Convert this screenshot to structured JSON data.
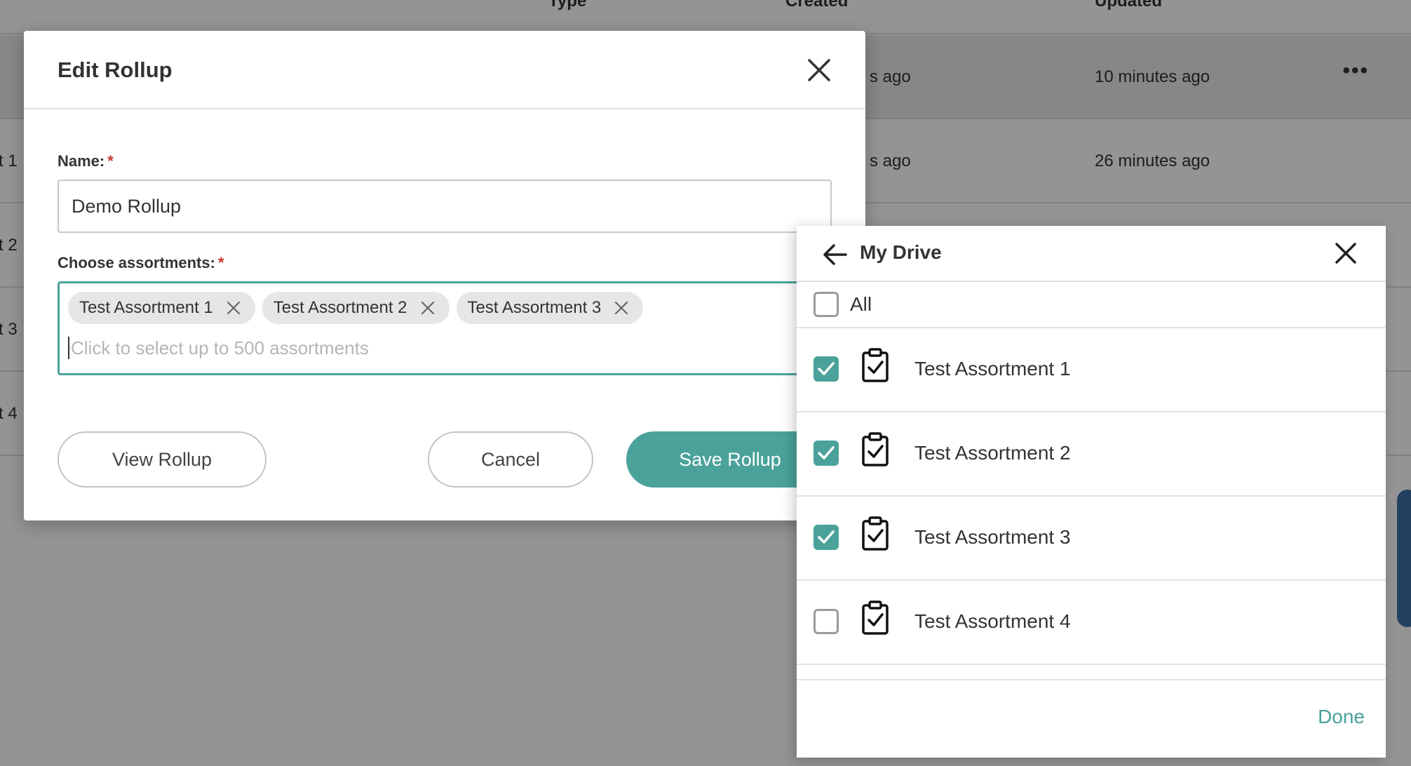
{
  "background": {
    "columns": {
      "type": "Type",
      "created": "Created",
      "updated": "Updated"
    },
    "rows": [
      {
        "name_fragment": "",
        "created": "s ago",
        "updated": "10 minutes ago",
        "more": "•••"
      },
      {
        "name_fragment": "t 1",
        "created": "s ago",
        "updated": "26 minutes ago"
      },
      {
        "name_fragment": "t 2"
      },
      {
        "name_fragment": "t 3"
      },
      {
        "name_fragment": "t 4"
      }
    ]
  },
  "modal": {
    "title": "Edit Rollup",
    "name_label": "Name:",
    "required_mark": "*",
    "name_value": "Demo Rollup",
    "assortments_label": "Choose assortments:",
    "selected": [
      "Test Assortment 1",
      "Test Assortment 2",
      "Test Assortment 3"
    ],
    "placeholder": "Click to select up to 500 assortments",
    "buttons": {
      "view": "View Rollup",
      "cancel": "Cancel",
      "save": "Save Rollup"
    }
  },
  "panel": {
    "title": "My Drive",
    "all_label": "All",
    "items": [
      {
        "label": "Test Assortment 1",
        "checked": true
      },
      {
        "label": "Test Assortment 2",
        "checked": true
      },
      {
        "label": "Test Assortment 3",
        "checked": true
      },
      {
        "label": "Test Assortment 4",
        "checked": false
      }
    ],
    "done_label": "Done"
  },
  "colors": {
    "accent": "#4aa29a",
    "required": "#c0392b",
    "backdrop": "rgba(0,0,0,0.42)"
  }
}
